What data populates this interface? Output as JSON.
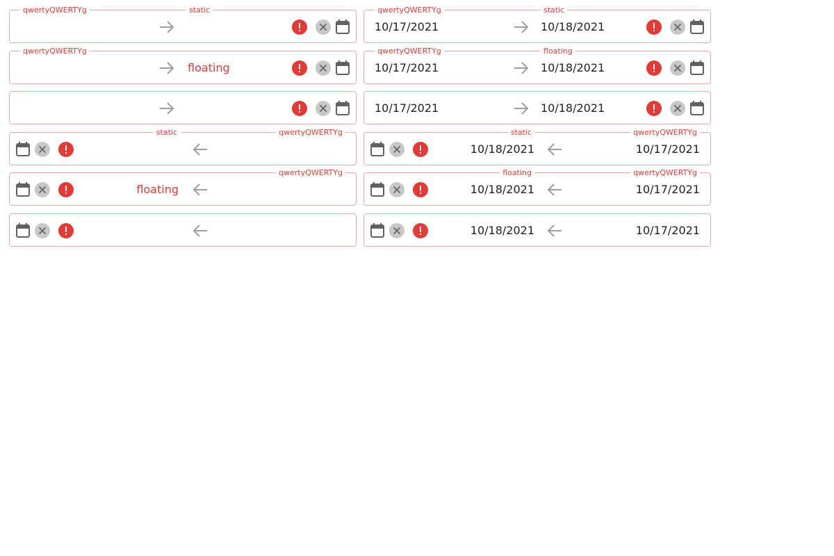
{
  "colors": {
    "error": "#e53935",
    "border": "#f0a8a8",
    "arrow": "#9e9e9e",
    "icon": "#616161",
    "text": "#212121"
  },
  "icons": [
    "arrow-right-icon",
    "arrow-left-icon",
    "error-icon",
    "clear-icon",
    "calendar-icon"
  ],
  "fields": [
    {
      "dir": "ltr",
      "start_label": "qwertyQWERTYg",
      "end_label": "static",
      "start_value": "",
      "end_value": "",
      "end_placeholder": ""
    },
    {
      "dir": "ltr",
      "start_label": "qwertyQWERTYg",
      "end_label": "static",
      "start_value": "10/17/2021",
      "end_value": "10/18/2021",
      "end_placeholder": ""
    },
    {
      "dir": "ltr",
      "start_label": "qwertyQWERTYg",
      "end_label": "",
      "start_value": "",
      "end_value": "",
      "end_placeholder": "floating"
    },
    {
      "dir": "ltr",
      "start_label": "qwertyQWERTYg",
      "end_label": "floating",
      "start_value": "10/17/2021",
      "end_value": "10/18/2021",
      "end_placeholder": ""
    },
    {
      "dir": "ltr",
      "start_label": "",
      "end_label": "",
      "start_value": "",
      "end_value": "",
      "end_placeholder": ""
    },
    {
      "dir": "ltr",
      "start_label": "",
      "end_label": "",
      "start_value": "10/17/2021",
      "end_value": "10/18/2021",
      "end_placeholder": ""
    },
    {
      "dir": "rtl",
      "start_label": "qwertyQWERTYg",
      "end_label": "static",
      "start_value": "",
      "end_value": "",
      "end_placeholder": ""
    },
    {
      "dir": "rtl",
      "start_label": "qwertyQWERTYg",
      "end_label": "static",
      "start_value": "10/17/2021",
      "end_value": "10/18/2021",
      "end_placeholder": ""
    },
    {
      "dir": "rtl",
      "start_label": "qwertyQWERTYg",
      "end_label": "",
      "start_value": "",
      "end_value": "",
      "end_placeholder": "floating"
    },
    {
      "dir": "rtl",
      "start_label": "qwertyQWERTYg",
      "end_label": "floating",
      "start_value": "10/17/2021",
      "end_value": "10/18/2021",
      "end_placeholder": ""
    },
    {
      "dir": "rtl",
      "start_label": "",
      "end_label": "",
      "start_value": "",
      "end_value": "",
      "end_placeholder": ""
    },
    {
      "dir": "rtl",
      "start_label": "",
      "end_label": "",
      "start_value": "10/17/2021",
      "end_value": "10/18/2021",
      "end_placeholder": ""
    }
  ]
}
